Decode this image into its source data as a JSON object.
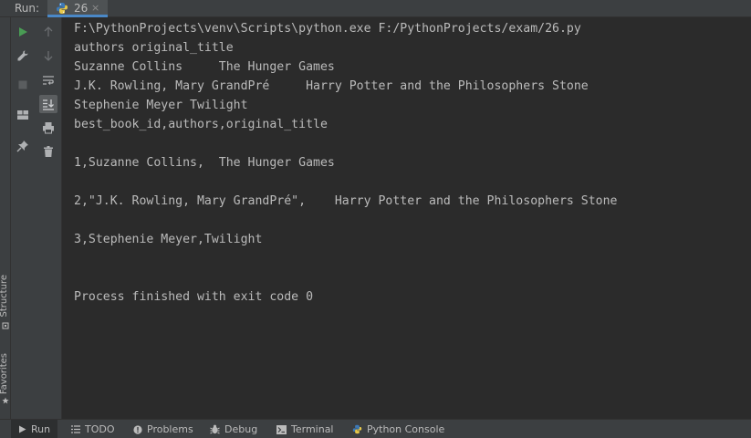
{
  "run_panel": {
    "label": "Run:",
    "tab": {
      "name": "26",
      "close": "×"
    }
  },
  "side_strip": {
    "structure": "Structure",
    "favorites": "Favorites"
  },
  "console": {
    "lines": [
      "F:\\PythonProjects\\venv\\Scripts\\python.exe F:/PythonProjects/exam/26.py",
      "authors original_title",
      "Suzanne Collins     The Hunger Games",
      "J.K. Rowling, Mary GrandPré     Harry Potter and the Philosophers Stone",
      "Stephenie Meyer Twilight",
      "best_book_id,authors,original_title",
      "",
      "1,Suzanne Collins,  The Hunger Games",
      "",
      "2,\"J.K. Rowling, Mary GrandPré\",    Harry Potter and the Philosophers Stone",
      "",
      "3,Stephenie Meyer,Twilight",
      "",
      "",
      "Process finished with exit code 0"
    ]
  },
  "bottom_bar": {
    "items": [
      {
        "label": "Run",
        "icon": "play-icon"
      },
      {
        "label": "TODO",
        "icon": "list-icon"
      },
      {
        "label": "Problems",
        "icon": "info-icon"
      },
      {
        "label": "Debug",
        "icon": "bug-icon"
      },
      {
        "label": "Terminal",
        "icon": "terminal-icon"
      },
      {
        "label": "Python Console",
        "icon": "python-icon"
      }
    ]
  },
  "colors": {
    "background": "#2b2b2b",
    "panel": "#3c3f41",
    "text": "#bbbbbb",
    "accent": "#4a88c7",
    "run_green": "#499c54"
  }
}
